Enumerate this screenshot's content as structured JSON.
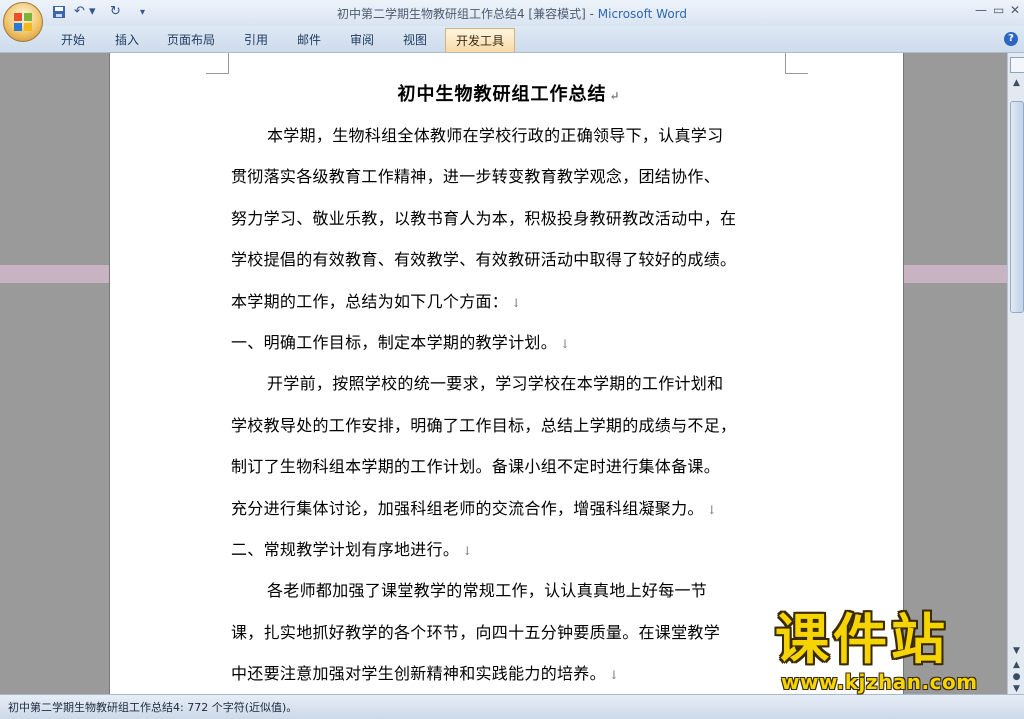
{
  "window": {
    "title": "初中第二学期生物教研组工作总结4 [兼容模式] - ",
    "app_name": "Microsoft Word",
    "qat_undo": "↶ ▾",
    "qat_redo": "↻",
    "qat_customize": "▾",
    "minimize": "—",
    "maximize": "▭",
    "close": "✕"
  },
  "ribbon": {
    "tabs": [
      {
        "label": "开始"
      },
      {
        "label": "插入"
      },
      {
        "label": "页面布局"
      },
      {
        "label": "引用"
      },
      {
        "label": "邮件"
      },
      {
        "label": "审阅"
      },
      {
        "label": "视图"
      },
      {
        "label": "开发工具"
      }
    ],
    "help": "?"
  },
  "document": {
    "title": "初中生物教研组工作总结",
    "paragraph_mark": "↵",
    "line_break_mark": "↓",
    "lines": [
      "本学期，生物科组全体教师在学校行政的正确领导下，认真学习",
      "贯彻落实各级教育工作精神，进一步转变教育教学观念，团结协作、",
      "努力学习、敬业乐教，以教书育人为本，积极投身教研教改活动中，在",
      "学校提倡的有效教育、有效教学、有效教研活动中取得了较好的成绩。",
      "本学期的工作，总结为如下几个方面：",
      "一、明确工作目标，制定本学期的教学计划。",
      "开学前，按照学校的统一要求，学习学校在本学期的工作计划和",
      "学校教导处的工作安排，明确了工作目标，总结上学期的成绩与不足，",
      "制订了生物科组本学期的工作计划。备课小组不定时进行集体备课。",
      "充分进行集体讨论，加强科组老师的交流合作，增强科组凝聚力。",
      "二、常规教学计划有序地进行。",
      "各老师都加强了课堂教学的常规工作，认认真真地上好每一节",
      "课，扎实地抓好教学的各个环节，向四十五分钟要质量。在课堂教学",
      "中还要注意加强对学生创新精神和实践能力的培养。"
    ]
  },
  "status": {
    "text": "初中第二学期生物教研组工作总结4: 772 个字符(近似值)。"
  },
  "watermark": {
    "title": "课件站",
    "url": "www.kjzhan.com"
  },
  "colors": {
    "title_app_blue": "#2f66b5",
    "watermark_yellow": "#f5d400",
    "active_tab": "#f7d9a6"
  }
}
